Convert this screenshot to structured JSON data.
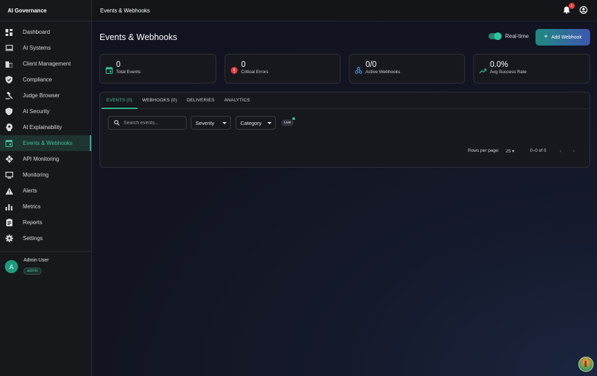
{
  "app_title": "AI Governance",
  "topbar": {
    "title": "Events & Webhooks",
    "notification_count": "1"
  },
  "sidebar": {
    "items": [
      {
        "label": "Dashboard",
        "icon": "dashboard-icon"
      },
      {
        "label": "AI Systems",
        "icon": "laptop-icon"
      },
      {
        "label": "Client Management",
        "icon": "business-icon"
      },
      {
        "label": "Compliance",
        "icon": "shield-check-icon"
      },
      {
        "label": "Judge Browser",
        "icon": "gavel-icon"
      },
      {
        "label": "AI Security",
        "icon": "shield-icon"
      },
      {
        "label": "AI Explainability",
        "icon": "psychology-icon"
      },
      {
        "label": "Events & Webhooks",
        "icon": "event-icon",
        "active": true
      },
      {
        "label": "API Monitoring",
        "icon": "api-icon"
      },
      {
        "label": "Monitoring",
        "icon": "monitor-icon"
      },
      {
        "label": "Alerts",
        "icon": "warning-icon"
      },
      {
        "label": "Metrics",
        "icon": "bar-chart-icon"
      },
      {
        "label": "Reports",
        "icon": "report-icon"
      },
      {
        "label": "Settings",
        "icon": "gear-icon"
      }
    ],
    "user": {
      "initial": "A",
      "name": "Admin User",
      "role": "admin"
    }
  },
  "page": {
    "title": "Events & Webhooks",
    "realtime_label": "Real-time",
    "realtime_on": true,
    "add_button": "Add Webhook"
  },
  "stats": [
    {
      "value": "0",
      "label": "Total Events",
      "icon": "event-icon",
      "color": "#2bc6a0"
    },
    {
      "value": "0",
      "label": "Critical Errors",
      "icon": "error-icon",
      "color": "#e0393a"
    },
    {
      "value": "0/0",
      "label": "Active Webhooks",
      "icon": "webhook-icon",
      "color": "#4f8fe0"
    },
    {
      "value": "0.0%",
      "label": "Avg Success Rate",
      "icon": "trending-up-icon",
      "color": "#2bc6a0"
    }
  ],
  "tabs": [
    "EVENTS (0)",
    "WEBHOOKS (0)",
    "DELIVERIES",
    "ANALYTICS"
  ],
  "filters": {
    "search_placeholder": "Search events...",
    "severity": "Severity",
    "category": "Category",
    "live": "Live"
  },
  "pagination": {
    "rows_label": "Rows per page:",
    "rows_value": "25",
    "range": "0–0 of 0"
  },
  "colors": {
    "accent": "#2bb38f",
    "error": "#e0393a"
  }
}
